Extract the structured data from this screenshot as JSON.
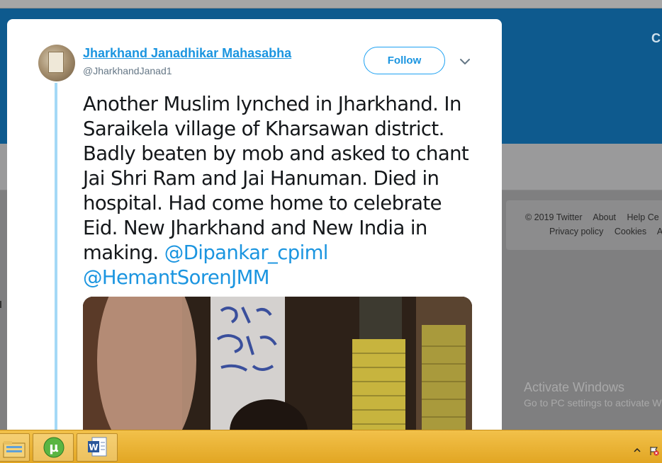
{
  "tweet": {
    "author_name": "Jharkhand Janadhikar Mahasabha",
    "author_handle": "@JharkhandJanad1",
    "follow_label": "Follow",
    "text_plain": "Another Muslim lynched in Jharkhand. In Saraikela village of Kharsawan district. Badly beaten by mob and asked to chant Jai Shri Ram and Jai Hanuman. Died in hospital. Had come home to celebrate Eid. New Jharkhand and New India in making.",
    "mentions": [
      "@Dipankar_cpiml",
      "@HemantSorenJMM"
    ]
  },
  "footer": {
    "copyright": "© 2019 Twitter",
    "about": "About",
    "help": "Help Ce",
    "privacy": "Privacy policy",
    "cookies": "Cookies",
    "ads": "A"
  },
  "windows": {
    "activate_title": "Activate Windows",
    "activate_sub": "Go to PC settings to activate W"
  },
  "background": {
    "blue_label": "C"
  },
  "colors": {
    "twitter_blue": "#1b95e0",
    "thread_line": "#a4d9f6",
    "taskbar": "#e9b032"
  }
}
